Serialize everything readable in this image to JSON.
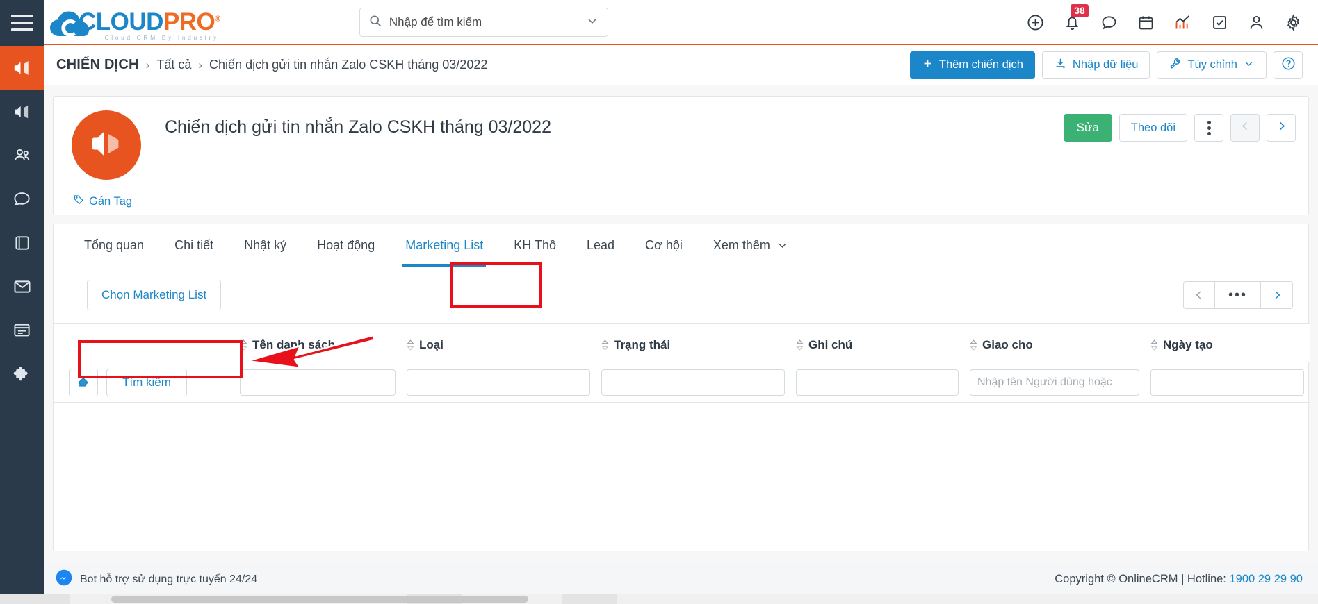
{
  "sidebar": {
    "menu_icon": "hamburger-icon",
    "items": [
      {
        "icon": "megaphone-icon",
        "name": "campaigns",
        "active": true
      },
      {
        "icon": "megaphone-outline-icon",
        "name": "marketing",
        "active": false
      },
      {
        "icon": "people-icon",
        "name": "customers",
        "active": false
      },
      {
        "icon": "chat-icon",
        "name": "chat",
        "active": false
      },
      {
        "icon": "book-icon",
        "name": "knowledge",
        "active": false
      },
      {
        "icon": "mail-icon",
        "name": "email",
        "active": false
      },
      {
        "icon": "list-icon",
        "name": "lists",
        "active": false
      },
      {
        "icon": "puzzle-icon",
        "name": "addons",
        "active": false
      }
    ]
  },
  "header": {
    "logo": {
      "cloud": "CLOUD",
      "pro": "PRO",
      "registered": "®",
      "tagline": "Cloud CRM By Industry"
    },
    "search": {
      "placeholder": "Nhập để tìm kiếm",
      "value": "",
      "icon": "search-icon",
      "caret_icon": "chevron-down-icon"
    },
    "icons": [
      {
        "name": "add-circle-icon",
        "badge": ""
      },
      {
        "name": "bell-icon",
        "badge": "38"
      },
      {
        "name": "chat-bubble-icon",
        "badge": ""
      },
      {
        "name": "calendar-icon",
        "badge": ""
      },
      {
        "name": "analytics-icon",
        "badge": ""
      },
      {
        "name": "task-check-icon",
        "badge": ""
      },
      {
        "name": "user-icon",
        "badge": ""
      },
      {
        "name": "gear-icon",
        "badge": ""
      }
    ]
  },
  "breadcrumb": {
    "root": "CHIẾN DỊCH",
    "sep": "›",
    "parent": "Tất cả",
    "current": "Chiến dịch gửi tin nhắn Zalo CSKH tháng 03/2022"
  },
  "page_actions": {
    "add_label": "Thêm chiến dịch",
    "add_icon": "plus-icon",
    "import_label": "Nhập dữ liệu",
    "import_icon": "download-icon",
    "customize_label": "Tùy chỉnh",
    "customize_icon": "wrench-icon",
    "customize_caret": "chevron-down-icon",
    "help_label": "?"
  },
  "campaign": {
    "avatar_icon": "megaphone-icon",
    "avatar_color": "#e8541f",
    "title": "Chiến dịch gửi tin nhắn Zalo CSKH tháng 03/2022",
    "tag_label": "Gán Tag",
    "tag_icon": "tag-icon",
    "edit_label": "Sửa",
    "follow_label": "Theo dõi",
    "more_icon": "vertical-dots-icon",
    "prev_icon": "chevron-left-icon",
    "next_icon": "chevron-right-icon"
  },
  "tabs": [
    {
      "label": "Tổng quan",
      "active": false
    },
    {
      "label": "Chi tiết",
      "active": false
    },
    {
      "label": "Nhật ký",
      "active": false
    },
    {
      "label": "Hoạt động",
      "active": false
    },
    {
      "label": "Marketing List",
      "active": true
    },
    {
      "label": "KH Thô",
      "active": false
    },
    {
      "label": "Lead",
      "active": false
    },
    {
      "label": "Cơ hội",
      "active": false
    },
    {
      "label": "Xem thêm",
      "active": false,
      "caret": "chevron-down-icon"
    }
  ],
  "list_toolbar": {
    "choose_label": "Chọn Marketing List",
    "pager_prev_icon": "chevron-left-icon",
    "pager_more_label": "•••",
    "pager_next_icon": "chevron-right-icon"
  },
  "table": {
    "columns": [
      {
        "label": "",
        "sortable": false
      },
      {
        "label": "Tên danh sách",
        "sortable": true
      },
      {
        "label": "Loại",
        "sortable": true
      },
      {
        "label": "Trạng thái",
        "sortable": true
      },
      {
        "label": "Ghi chú",
        "sortable": true
      },
      {
        "label": "Giao cho",
        "sortable": true
      },
      {
        "label": "Ngày tạo",
        "sortable": true
      }
    ],
    "filter_row": {
      "clear_icon": "eraser-icon",
      "search_label": "Tìm kiếm",
      "inputs": [
        {
          "name": "ten-danh-sach",
          "value": "",
          "placeholder": ""
        },
        {
          "name": "loai",
          "value": "",
          "placeholder": ""
        },
        {
          "name": "trang-thai",
          "value": "",
          "placeholder": ""
        },
        {
          "name": "ghi-chu",
          "value": "",
          "placeholder": ""
        },
        {
          "name": "giao-cho",
          "value": "",
          "placeholder": "Nhập tên Người dùng hoặc"
        },
        {
          "name": "ngay-tao",
          "value": "",
          "placeholder": ""
        }
      ]
    },
    "rows": []
  },
  "footer": {
    "bot_icon": "messenger-icon",
    "bot_label": "Bot hỗ trợ sử dụng trực tuyến 24/24",
    "copyright": "Copyright © OnlineCRM | Hotline: ",
    "hotline": "1900 29 29 90"
  },
  "annotations": {
    "tab_box": "Marketing List",
    "button_box": "Chọn Marketing List",
    "arrow_color": "#e8111b"
  }
}
